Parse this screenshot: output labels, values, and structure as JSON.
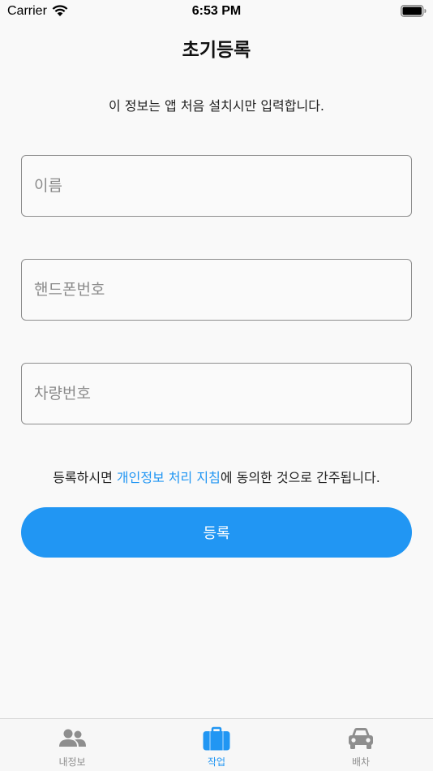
{
  "status_bar": {
    "carrier": "Carrier",
    "time": "6:53 PM"
  },
  "page": {
    "title": "초기등록",
    "subtitle": "이 정보는 앱 처음 설치시만 입력합니다."
  },
  "form": {
    "name_placeholder": "이름",
    "phone_placeholder": "핸드폰번호",
    "car_placeholder": "차량번호",
    "consent_prefix": "등록하시면 ",
    "consent_link": "개인정보 처리 지침",
    "consent_suffix": "에 동의한 것으로 간주됩니다.",
    "submit_label": "등록"
  },
  "tab_bar": {
    "items": [
      {
        "label": "내정보",
        "icon": "people-icon",
        "active": false
      },
      {
        "label": "작업",
        "icon": "briefcase-icon",
        "active": true
      },
      {
        "label": "배차",
        "icon": "car-icon",
        "active": false
      }
    ]
  },
  "colors": {
    "accent": "#2196f3",
    "inactive": "#8e8e8e",
    "background": "#f9f9f9"
  }
}
